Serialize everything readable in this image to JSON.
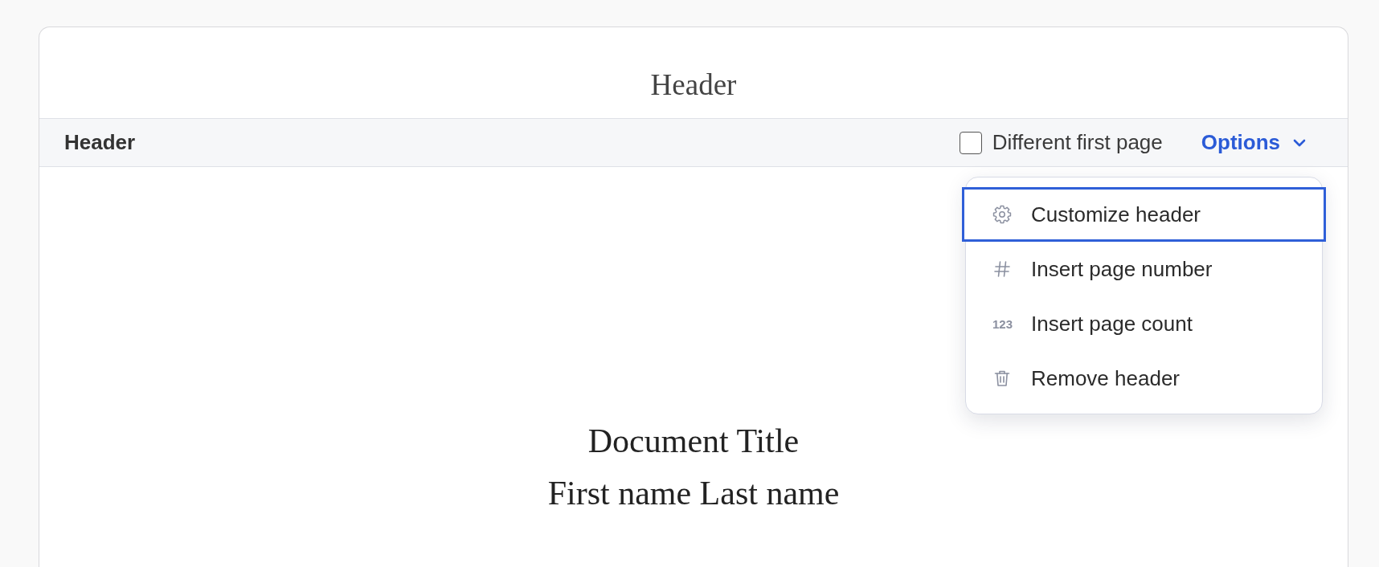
{
  "header_preview": {
    "text": "Header"
  },
  "toolbar": {
    "title": "Header",
    "different_first_page": {
      "label": "Different first page",
      "checked": false
    },
    "options_button": {
      "label": "Options",
      "expanded": true,
      "menu_items": [
        {
          "kind": "customize",
          "label": "Customize header",
          "focused": true
        },
        {
          "kind": "page_number",
          "label": "Insert page number",
          "focused": false
        },
        {
          "kind": "page_count",
          "glyph": "123",
          "label": "Insert page count",
          "focused": false
        },
        {
          "kind": "remove",
          "label": "Remove header",
          "focused": false
        }
      ]
    }
  },
  "document": {
    "title": "Document Title",
    "author": "First name Last name"
  }
}
